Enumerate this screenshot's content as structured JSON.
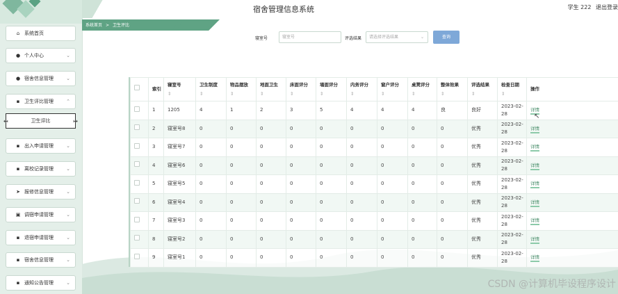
{
  "app": {
    "title": "宿舍管理信息系统",
    "user_label": "学生 222",
    "logout_label": "退出登录"
  },
  "breadcrumb": {
    "home": "系统首页",
    "separator": ">",
    "current": "卫生评比"
  },
  "sidebar": {
    "items": [
      {
        "label": "系统首页",
        "icon": "home-icon",
        "has_chevron": false
      },
      {
        "label": "个人中心",
        "icon": "person-icon",
        "has_chevron": true
      },
      {
        "label": "宿舍信息管理",
        "icon": "person-icon",
        "has_chevron": true
      },
      {
        "label": "卫生评比管理",
        "icon": "grid-icon",
        "has_chevron": true,
        "expanded": true
      },
      {
        "label": "出入申请管理",
        "icon": "grid-icon",
        "has_chevron": true
      },
      {
        "label": "离校记录管理",
        "icon": "grid-icon",
        "has_chevron": true
      },
      {
        "label": "报修信息管理",
        "icon": "send-icon",
        "has_chevron": true
      },
      {
        "label": "调宿申请管理",
        "icon": "clipboard-icon",
        "has_chevron": true
      },
      {
        "label": "退宿申请管理",
        "icon": "grid-icon",
        "has_chevron": true
      },
      {
        "label": "宿舍信息管理",
        "icon": "grid-icon",
        "has_chevron": true
      },
      {
        "label": "通知公告管理",
        "icon": "grid-icon",
        "has_chevron": true
      }
    ],
    "active_sub_item": "卫生评比"
  },
  "search": {
    "dorm_label": "寝室号",
    "dorm_placeholder": "寝室号",
    "result_label": "评选结果",
    "result_placeholder": "请选择评选结果",
    "search_button": "查询"
  },
  "table": {
    "headers": [
      {
        "label": "",
        "sortable": false
      },
      {
        "label": "索引",
        "sortable": false
      },
      {
        "label": "寝室号",
        "sortable": true
      },
      {
        "label": "卫生制度",
        "sortable": true
      },
      {
        "label": "物品摆放",
        "sortable": true
      },
      {
        "label": "地面卫生",
        "sortable": true
      },
      {
        "label": "床面评分",
        "sortable": true
      },
      {
        "label": "墙面评分",
        "sortable": true
      },
      {
        "label": "内务评分",
        "sortable": true
      },
      {
        "label": "窗户评分",
        "sortable": true
      },
      {
        "label": "桌凳评分",
        "sortable": true
      },
      {
        "label": "整体效果",
        "sortable": true
      },
      {
        "label": "评选结果",
        "sortable": true
      },
      {
        "label": "检查日期",
        "sortable": true
      },
      {
        "label": "操作",
        "sortable": false
      }
    ],
    "action_label": "详情",
    "rows": [
      [
        "1",
        "1205",
        "4",
        "1",
        "2",
        "3",
        "5",
        "4",
        "4",
        "4",
        "良",
        "良好",
        "2023-02-28"
      ],
      [
        "2",
        "寝室号8",
        "0",
        "0",
        "0",
        "0",
        "0",
        "0",
        "0",
        "0",
        "0",
        "优秀",
        "2023-02-28"
      ],
      [
        "3",
        "寝室号7",
        "0",
        "0",
        "0",
        "0",
        "0",
        "0",
        "0",
        "0",
        "0",
        "优秀",
        "2023-02-28"
      ],
      [
        "4",
        "寝室号6",
        "0",
        "0",
        "0",
        "0",
        "0",
        "0",
        "0",
        "0",
        "0",
        "优秀",
        "2023-02-28"
      ],
      [
        "5",
        "寝室号5",
        "0",
        "0",
        "0",
        "0",
        "0",
        "0",
        "0",
        "0",
        "0",
        "优秀",
        "2023-02-28"
      ],
      [
        "6",
        "寝室号4",
        "0",
        "0",
        "0",
        "0",
        "0",
        "0",
        "0",
        "0",
        "0",
        "优秀",
        "2023-02-28"
      ],
      [
        "7",
        "寝室号3",
        "0",
        "0",
        "0",
        "0",
        "0",
        "0",
        "0",
        "0",
        "0",
        "优秀",
        "2023-02-28"
      ],
      [
        "8",
        "寝室号2",
        "0",
        "0",
        "0",
        "0",
        "0",
        "0",
        "0",
        "0",
        "0",
        "优秀",
        "2023-02-28"
      ],
      [
        "9",
        "寝室号1",
        "0",
        "0",
        "0",
        "0",
        "0",
        "0",
        "0",
        "0",
        "0",
        "优秀",
        "2023-02-28"
      ]
    ]
  },
  "watermark": "CSDN @计算机毕设程序设计",
  "colors": {
    "sidebar_bg": "#e4efe9",
    "accent_green": "#5fa384",
    "search_button": "#7ea8d8",
    "link": "#4b8f6d"
  }
}
